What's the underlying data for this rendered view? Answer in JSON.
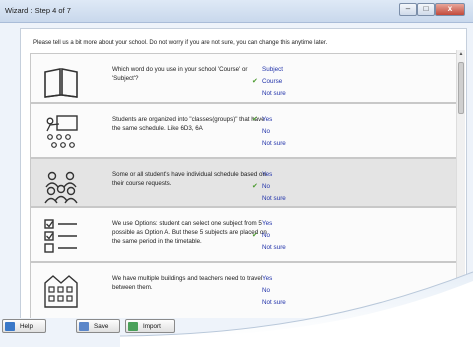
{
  "window": {
    "title": "Wizard : Step 4 of 7"
  },
  "instruction": "Please tell us a bit more about your school. Do not worry if you are not sure, you can change this anytime later.",
  "questions": [
    {
      "text": "Which word do you use in your school 'Course' or 'Subject'?",
      "icon": "book-icon",
      "options": [
        "Subject",
        "Course",
        "Not sure"
      ],
      "selected": 1
    },
    {
      "text": "Students are organized into \"classes(groups)\" that have the same schedule. Like 6D3, 6A",
      "icon": "classroom-teacher-icon",
      "options": [
        "Yes",
        "No",
        "Not sure"
      ],
      "selected": 0
    },
    {
      "text": "Some or all student's have individual schedule based on their course requests.",
      "icon": "students-group-icon",
      "options": [
        "Yes",
        "No",
        "Not sure"
      ],
      "selected": 1
    },
    {
      "text": "We use Options: student can select one subject from 5 possible as Option A. But these 5 subjects are placed on the same period in the timetable.",
      "icon": "checklist-icon",
      "options": [
        "Yes",
        "No",
        "Not sure"
      ],
      "selected": 1
    },
    {
      "text": "We have multiple buildings and teachers need to travel between them.",
      "icon": "building-icon",
      "options": [
        "Yes",
        "No",
        "Not sure"
      ],
      "selected": -1
    }
  ],
  "buttons": {
    "help": "Help",
    "save": "Save",
    "import": "Import"
  },
  "colors": {
    "link": "#2233aa",
    "check": "#4a9a2e"
  }
}
